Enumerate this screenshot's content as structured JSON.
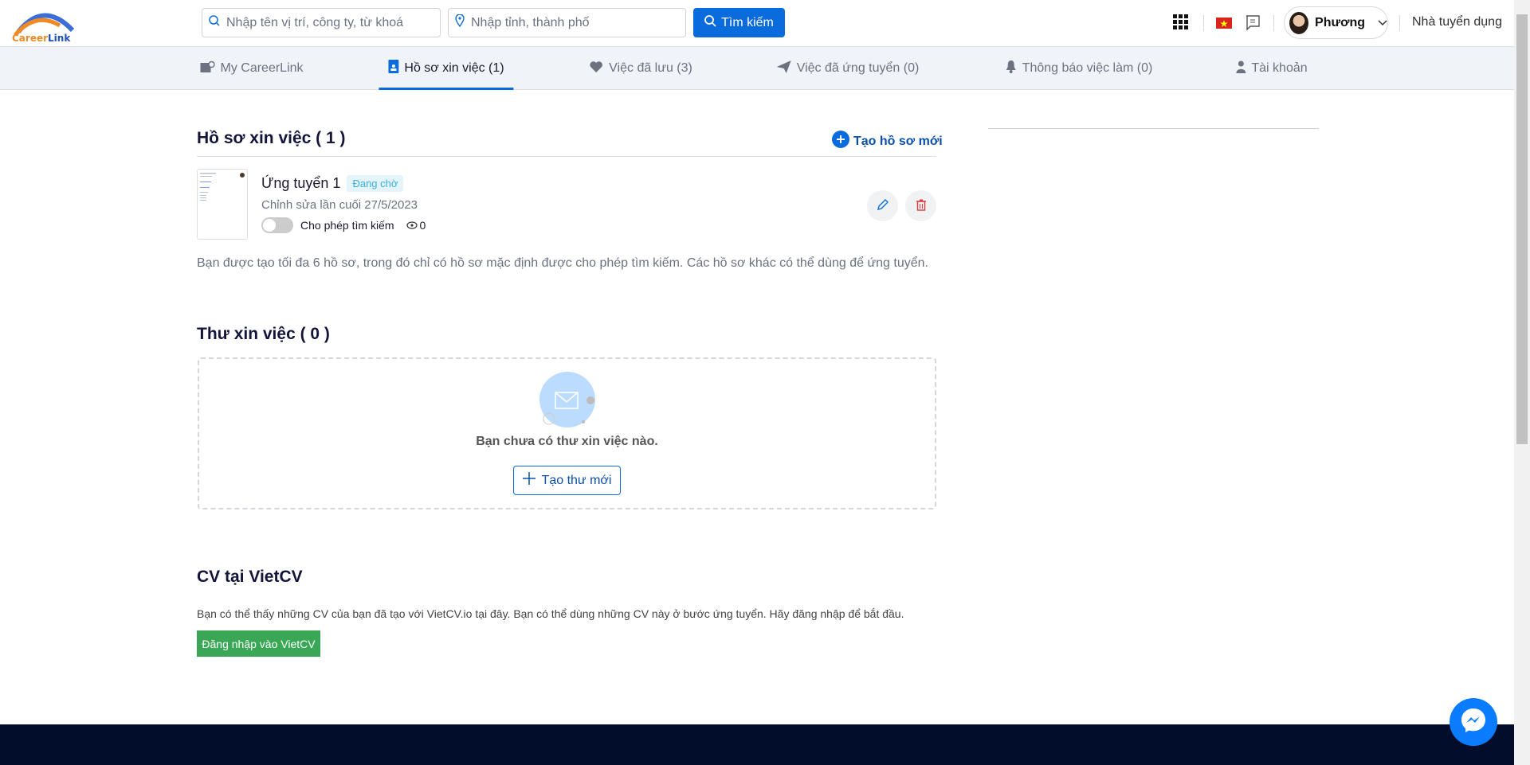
{
  "header": {
    "logo_text": "CareerLink",
    "keyword_placeholder": "Nhập tên vị trí, công ty, từ khoá",
    "location_placeholder": "Nhập tỉnh, thành phố",
    "search_label": "Tìm kiếm",
    "user_name": "Phương",
    "employer_link": "Nhà tuyển dụng"
  },
  "nav": {
    "items": [
      {
        "label": "My CareerLink"
      },
      {
        "label": "Hồ sơ xin việc (1)"
      },
      {
        "label": "Việc đã lưu (3)"
      },
      {
        "label": "Việc đã ứng tuyển (0)"
      },
      {
        "label": "Thông báo việc làm (0)"
      },
      {
        "label": "Tài khoản"
      }
    ]
  },
  "resumes": {
    "title": "Hồ sơ xin việc ( 1 )",
    "create_label": "Tạo hồ sơ mới",
    "item": {
      "name": "Ứng tuyển 1",
      "status": "Đang chờ",
      "edited": "Chỉnh sửa lần cuối 27/5/2023",
      "toggle_label": "Cho phép tìm kiếm",
      "views": "0"
    },
    "note": "Bạn được tạo tối đa 6 hồ sơ, trong đó chỉ có hồ sơ mặc định được cho phép tìm kiếm. Các hồ sơ khác có thể dùng để ứng tuyển."
  },
  "letters": {
    "title": "Thư xin việc ( 0 )",
    "empty": "Bạn chưa có thư xin việc nào.",
    "create_label": "Tạo thư mới"
  },
  "vietcv": {
    "title": "CV tại VietCV",
    "text": "Bạn có thể thấy những CV của bạn đã tạo với VietCV.io tại đây. Bạn có thể dùng những CV này ở bước ứng tuyển. Hãy đăng nhập để bắt đầu.",
    "login_label": "Đăng nhập vào VietCV"
  },
  "colors": {
    "primary": "#0a6bdc",
    "green": "#3aa757",
    "footer": "#020c2b"
  }
}
